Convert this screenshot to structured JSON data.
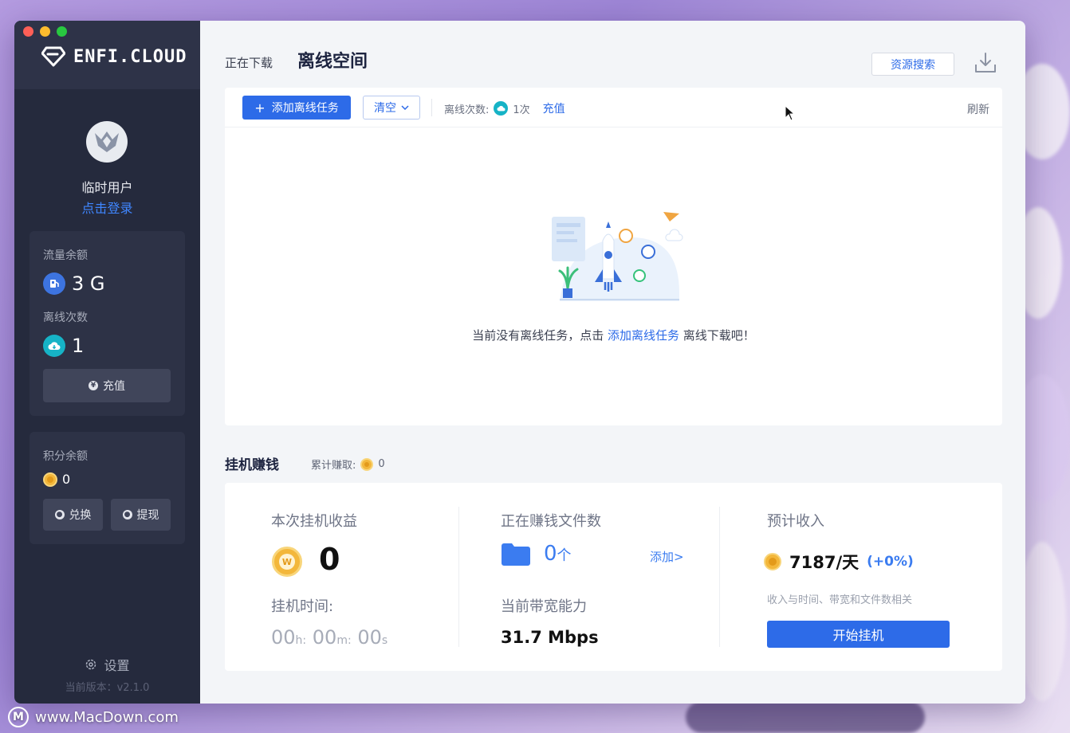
{
  "sidebar": {
    "logo_text": "ENFI.CLOUD",
    "username": "临时用户",
    "login_link": "点击登录",
    "traffic": {
      "label": "流量余额",
      "value": "3 G"
    },
    "offline": {
      "label": "离线次数",
      "value": "1"
    },
    "recharge_btn": "充值",
    "points": {
      "label": "积分余额",
      "value": "0"
    },
    "exchange_btn": "兑换",
    "withdraw_btn": "提现",
    "settings": "设置",
    "version": "当前版本：v2.1.0"
  },
  "header": {
    "tab_downloading": "正在下载",
    "tab_offline": "离线空间",
    "resource_search": "资源搜索"
  },
  "toolbar": {
    "add_task": "添加离线任务",
    "clear": "清空",
    "offline_count_label": "离线次数:",
    "offline_count_value": "1次",
    "recharge": "充值",
    "refresh": "刷新"
  },
  "empty": {
    "prefix": "当前没有离线任务，点击 ",
    "link": "添加离线任务",
    "suffix": " 离线下载吧！"
  },
  "earn": {
    "title": "挂机赚钱",
    "accumulated_label": "累计赚取:",
    "accumulated_value": "0",
    "session_label": "本次挂机收益",
    "session_value": "0",
    "time_label": "挂机时间:",
    "time_h": "00",
    "time_m": "00",
    "time_s": "00",
    "time_h_unit": "h:",
    "time_m_unit": "m:",
    "time_s_unit": "s",
    "files_label": "正在赚钱文件数",
    "files_value": "0",
    "files_unit": "个",
    "add_link": "添加>",
    "bandwidth_label": "当前带宽能力",
    "bandwidth_value": "31.7 Mbps",
    "estimate_label": "预计收入",
    "estimate_value": "7187/天",
    "estimate_pct": "(+0%)",
    "hint": "收入与时间、带宽和文件数相关",
    "start_btn": "开始挂机"
  },
  "watermark": "www.MacDown.com",
  "colors": {
    "accent": "#2d6be8",
    "sidebar_bg": "#252a3d",
    "coin": "#f3b73b",
    "teal": "#16b3c6"
  }
}
